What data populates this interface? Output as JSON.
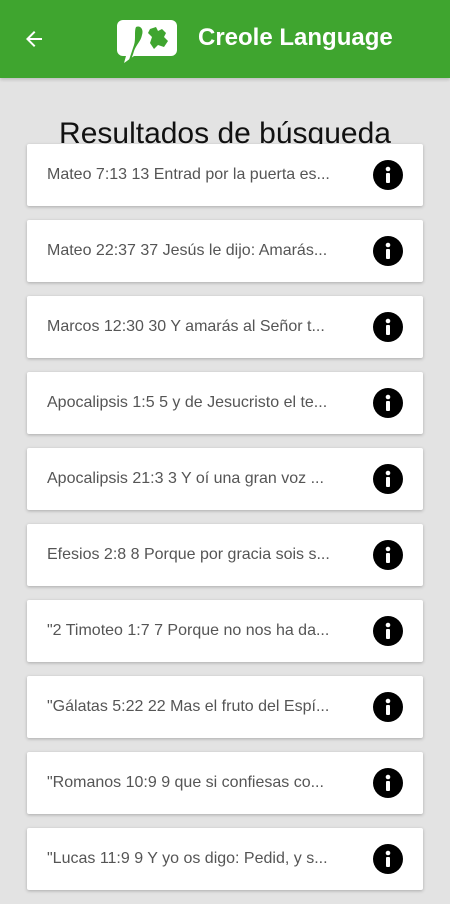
{
  "app": {
    "title": "Creole Language",
    "colors": {
      "appbar": "#3fa52f",
      "background": "#e3e3e3",
      "card": "#ffffff",
      "info_icon": "#000000"
    }
  },
  "page": {
    "title": "Resultados de búsqueda"
  },
  "results": [
    {
      "text": "Mateo 7:13 13 Entrad por la puerta es...",
      "icon": "info-icon"
    },
    {
      "text": "Mateo 22:37 37 Jesús le dijo: Amarás...",
      "icon": "info-icon"
    },
    {
      "text": "Marcos 12:30 30 Y amarás al Señor t...",
      "icon": "info-icon"
    },
    {
      "text": "Apocalipsis 1:5 5 y de Jesucristo el te...",
      "icon": "info-icon"
    },
    {
      "text": "Apocalipsis 21:3 3 Y oí una gran voz ...",
      "icon": "info-icon"
    },
    {
      "text": "Efesios 2:8 8 Porque por gracia sois s...",
      "icon": "info-icon"
    },
    {
      "text": "\"2 Timoteo 1:7 7 Porque no nos ha da...",
      "icon": "info-icon"
    },
    {
      "text": "\"Gálatas 5:22 22 Mas el fruto del Espí...",
      "icon": "info-icon"
    },
    {
      "text": "\"Romanos 10:9 9 que si confiesas co...",
      "icon": "info-icon"
    },
    {
      "text": "\"Lucas 11:9 9 Y yo os digo: Pedid, y s...",
      "icon": "info-icon"
    }
  ]
}
